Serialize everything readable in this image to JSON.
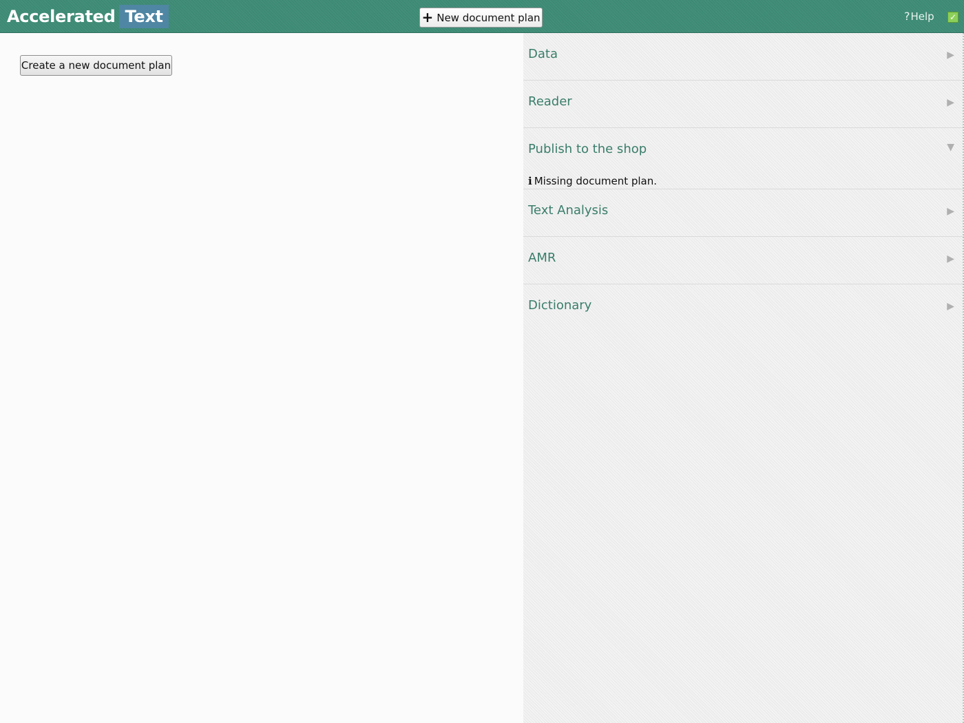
{
  "header": {
    "brand_part1": "Accelerated",
    "brand_part2": "Text",
    "new_plan_label": "New document plan",
    "help_label": "Help"
  },
  "main": {
    "create_label": "Create a new document plan"
  },
  "sidebar": {
    "panels": [
      {
        "title": "Data",
        "expanded": false
      },
      {
        "title": "Reader",
        "expanded": false
      },
      {
        "title": "Publish to the shop",
        "expanded": true,
        "message": "Missing document plan."
      },
      {
        "title": "Text Analysis",
        "expanded": false
      },
      {
        "title": "AMR",
        "expanded": false
      },
      {
        "title": "Dictionary",
        "expanded": false
      }
    ]
  },
  "colors": {
    "header_bg": "#3d8a74",
    "brand_accent": "#4f86a3",
    "panel_title": "#3a7d6a",
    "status_ok": "#8cd05a"
  },
  "icons": {
    "new_plan": "plus-icon",
    "help": "question-icon",
    "status": "check-icon",
    "collapsed": "triangle-right-icon",
    "expanded": "triangle-down-icon",
    "info": "info-icon"
  }
}
